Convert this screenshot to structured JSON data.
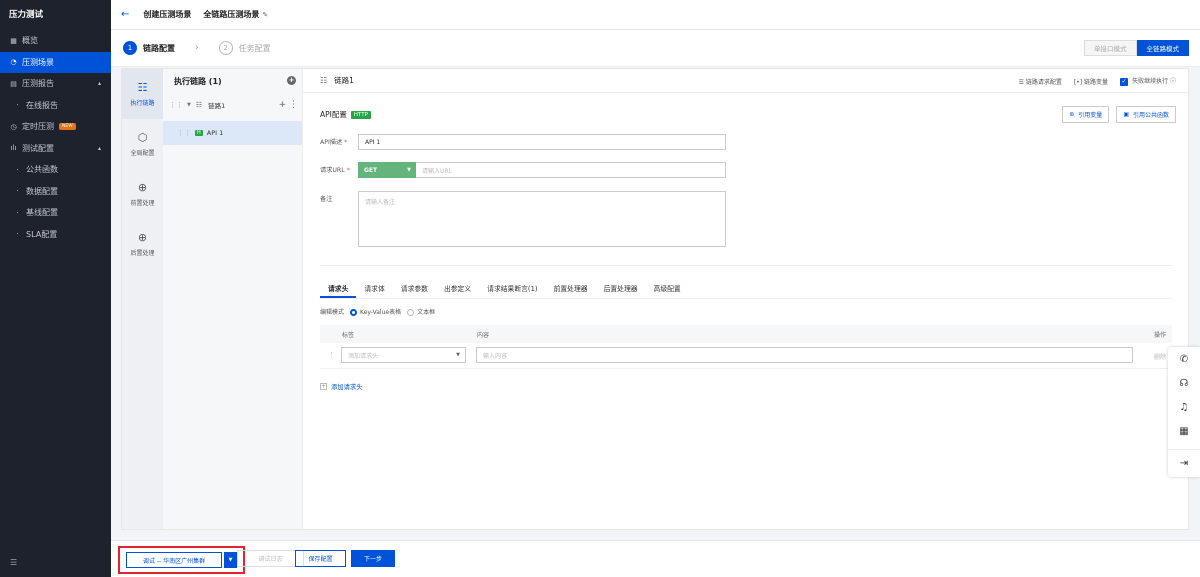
{
  "nav": {
    "title": "压力测试",
    "items": [
      {
        "label": "概览",
        "icon": "grid-icon"
      },
      {
        "label": "压测场景",
        "icon": "scene-icon"
      },
      {
        "label": "压测报告",
        "icon": "report-icon"
      },
      {
        "label": "在线报告"
      },
      {
        "label": "定时压测",
        "icon": "clock-icon",
        "badge": "NEW"
      },
      {
        "label": "测试配置",
        "icon": "config-icon"
      },
      {
        "label": "公共函数"
      },
      {
        "label": "数据配置"
      },
      {
        "label": "基线配置"
      },
      {
        "label": "SLA配置"
      }
    ]
  },
  "header": {
    "crumb1": "创建压测场景",
    "crumb2": "全链路压测场景"
  },
  "steps": [
    {
      "num": "1",
      "label": "链路配置"
    },
    {
      "num": "2",
      "label": "任务配置"
    }
  ],
  "mode": {
    "single": "单接口模式",
    "full": "全链路模式"
  },
  "vtabs": [
    {
      "label": "执行链路",
      "icon": "chain-icon"
    },
    {
      "label": "全局配置",
      "icon": "global-icon"
    },
    {
      "label": "前置处理",
      "icon": "pre-process-icon"
    },
    {
      "label": "后置处理",
      "icon": "post-process-icon"
    }
  ],
  "tree": {
    "title": "执行链路 (1)",
    "chain": "链路1",
    "api_tag": "H",
    "api": "API 1"
  },
  "chain_bar": {
    "title": "链路1",
    "opt1": "链路请求配置",
    "opt2": "链路变量",
    "opt3": "失败继续执行"
  },
  "api": {
    "title": "API配置",
    "tag": "HTTP",
    "ref_var": "引用变量",
    "ref_func": "引用公共函数",
    "desc_label": "API描述",
    "desc_value": "API 1",
    "url_label": "请求URL",
    "method": "GET",
    "url_placeholder": "请输入URL",
    "note_label": "备注",
    "note_placeholder": "请输入备注"
  },
  "htabs": [
    "请求头",
    "请求体",
    "请求参数",
    "出参定义",
    "请求结果断言(1)",
    "前置处理器",
    "后置处理器",
    "高级配置"
  ],
  "edit": {
    "label": "编辑模式",
    "opt1": "Key-Value表格",
    "opt2": "文本框"
  },
  "kv": {
    "col_key": "标签",
    "col_content": "内容",
    "col_op": "操作",
    "key_placeholder": "添加请求头",
    "content_placeholder": "输入内容",
    "delete": "删除",
    "add": "添加请求头"
  },
  "bottom": {
    "debug": "调试 -- 华南区广州集群",
    "log": "调试日志",
    "save": "保存配置",
    "next": "下一步"
  },
  "colors": {
    "primary": "#0052d9",
    "nav_bg": "#1e222d",
    "http_tag": "#29a34a",
    "method_bg": "#64b47b",
    "highlight": "#e0252f"
  }
}
